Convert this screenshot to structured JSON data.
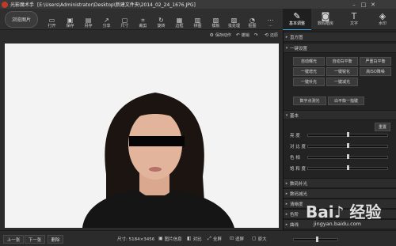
{
  "window": {
    "app_name": "光影魔术手",
    "path": "[E:\\Users\\Administrator\\Desktop\\新建文件夹\\2014_02_24_1676.JPG]",
    "controls": [
      "–",
      "□",
      "✕"
    ]
  },
  "toolbar": {
    "browse_label": "浏览图片",
    "tools": [
      {
        "label": "打开",
        "icon": "folder-open-icon",
        "glyph": "▭"
      },
      {
        "label": "保存",
        "icon": "save-icon",
        "glyph": "▣"
      },
      {
        "label": "另存",
        "icon": "save-as-icon",
        "glyph": "▤"
      },
      {
        "label": "分享",
        "icon": "share-icon",
        "glyph": "↗"
      },
      {
        "label": "尺寸",
        "icon": "resize-icon",
        "glyph": "▢"
      },
      {
        "label": "裁剪",
        "icon": "crop-icon",
        "glyph": "⌗"
      },
      {
        "label": "旋转",
        "icon": "rotate-icon",
        "glyph": "↻"
      },
      {
        "label": "边框",
        "icon": "border-icon",
        "glyph": "▦"
      },
      {
        "label": "拼图",
        "icon": "puzzle-icon",
        "glyph": "▥"
      },
      {
        "label": "模板",
        "icon": "template-icon",
        "glyph": "▧"
      },
      {
        "label": "批处理",
        "icon": "batch-icon",
        "glyph": "▨"
      },
      {
        "label": "抠图",
        "icon": "cutout-icon",
        "glyph": "◔"
      },
      {
        "label": "···",
        "icon": "more-icon",
        "glyph": "⋯"
      }
    ]
  },
  "modes": [
    {
      "label": "基本调整",
      "icon": "basic-adjust-icon",
      "glyph": "✎",
      "active": true
    },
    {
      "label": "数码暗房",
      "icon": "camera-icon",
      "glyph": "◙",
      "active": false
    },
    {
      "label": "文字",
      "icon": "text-icon",
      "glyph": "T",
      "active": false
    },
    {
      "label": "水印",
      "icon": "watermark-icon",
      "glyph": "◈",
      "active": false
    }
  ],
  "subbar": {
    "save_action": "保存动作",
    "undo": "撤销",
    "redo": "",
    "restore": "还原"
  },
  "panel": {
    "histogram": "直方图",
    "one_click": "一键设置",
    "buttons": [
      "自动曝光",
      "自动白平衡",
      "严重白平衡",
      "一键增光",
      "一键锐化",
      "高ISO降噪",
      "一键补光",
      "一键减光",
      "数字点测光",
      "白平衡一指键"
    ],
    "basic": "基本",
    "reset": "重置",
    "sliders": [
      {
        "label": "亮  度",
        "value": 0.5
      },
      {
        "label": "对 比 度",
        "value": 0.5
      },
      {
        "label": "色    相",
        "value": 0.5
      },
      {
        "label": "饱 和 度",
        "value": 0.5
      }
    ],
    "more_sections": [
      "数码补光",
      "数码减光",
      "清晰度",
      "色阶",
      "曲线"
    ]
  },
  "bottom": {
    "prev": "上一张",
    "next": "下一张",
    "delete": "删除",
    "size_text": "尺寸: 5184×3456",
    "info": "图片信息",
    "compare": "对比",
    "fullscreen": "全屏",
    "fit": "适屏",
    "original": "原大",
    "zoom_level": 0.5
  },
  "watermark": {
    "brand": "Bai♪ 经验",
    "url": "jingyan.baidu.com"
  },
  "colors": {
    "accent": "#3aa0e0",
    "app_logo": "#c0392b",
    "canvas_bg": "#f3f3f3",
    "redaction": "#050505",
    "shirt": "#151515",
    "hair": "#1b1410",
    "skin": "#e2b49b"
  }
}
